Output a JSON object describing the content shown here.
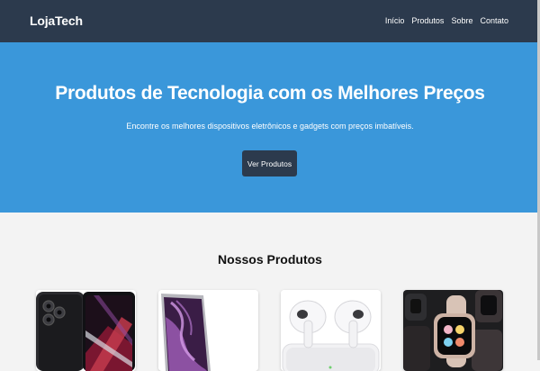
{
  "header": {
    "brand": "LojaTech",
    "nav": [
      "Início",
      "Produtos",
      "Sobre",
      "Contato"
    ]
  },
  "hero": {
    "title": "Produtos de Tecnologia com os Melhores Preços",
    "subtitle": "Encontre os melhores dispositivos eletrônicos e gadgets com preços imbatíveis.",
    "button": "Ver Produtos"
  },
  "products": {
    "title": "Nossos Produtos",
    "items": [
      {
        "icon": "smartphone-image"
      },
      {
        "icon": "laptop-image"
      },
      {
        "icon": "earbuds-image"
      },
      {
        "icon": "smartwatch-image"
      }
    ]
  },
  "colors": {
    "navbar": "#2c3a4d",
    "hero": "#3a97da",
    "button": "#2c3a4d",
    "background": "#f3f3f3"
  }
}
